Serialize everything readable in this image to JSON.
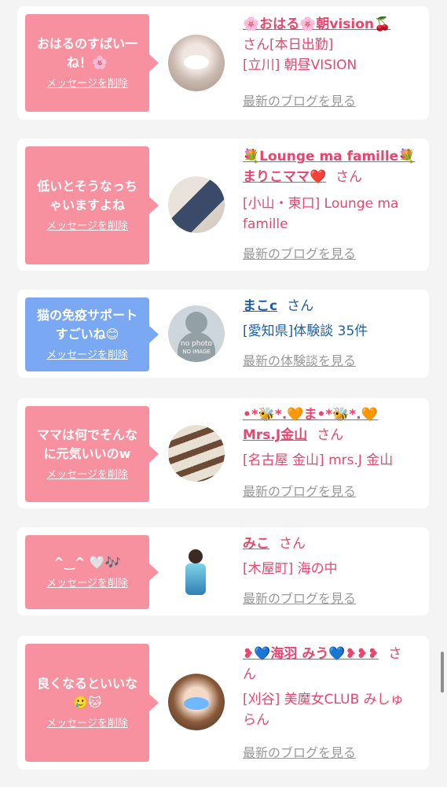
{
  "delete_label": "メッセージを削除",
  "colors": {
    "pink_bubble": "#f7909f",
    "blue_bubble": "#7aa8f2",
    "name_pink": "#e8466e",
    "name_blue": "#1f5fa8",
    "link_gray": "#999999"
  },
  "cards": [
    {
      "message": [
        "おはるのすばい一",
        "ね！🌸"
      ],
      "name": "🌸おはる🌸朝vision🍒",
      "san": "さん",
      "lines": [
        "さん[本日出勤]",
        "[立川] 朝昼VISION"
      ],
      "link": "最新のブログを見る"
    },
    {
      "message": [
        "低いとそうなっち",
        "ゃいますよね"
      ],
      "name_lines": [
        "💐Lounge ma famille💐",
        "まりこママ❤️"
      ],
      "san": "さん",
      "lines": [
        "[小山・東口] Lounge ma",
        "famille"
      ],
      "link": "最新のブログを見る"
    },
    {
      "message": [
        "猫の免疫サポート",
        "すごいね😊"
      ],
      "name": "まこc",
      "san": "さん",
      "lines": [
        "[愛知県]体験談 35件"
      ],
      "link": "最新の体験談を見る",
      "avatar_text": [
        "no photo",
        "NO IMAGE"
      ]
    },
    {
      "message": [
        "ママは何でそんな",
        "に元気いいのw"
      ],
      "name_lines": [
        "•*🐝*.🧡ま•*🐝*.🧡",
        "Mrs.J金山"
      ],
      "san": "さん",
      "lines": [
        "[名古屋 金山] mrs.J 金山"
      ],
      "link": "最新のブログを見る"
    },
    {
      "message": [
        "^‿^ 🤍🎶"
      ],
      "name": "みこ",
      "san": "さん",
      "lines": [
        "[木屋町] 海の中"
      ],
      "link": "最新のブログを見る"
    },
    {
      "message": [
        "良くなるといいな",
        "🥲🐱"
      ],
      "name": "❥💙海羽 みう💙❥❥❥",
      "san": "さ",
      "san2": "ん",
      "lines": [
        "[刈谷] 美魔女CLUB みしゅ",
        "らん"
      ],
      "link": "最新のブログを見る"
    }
  ]
}
